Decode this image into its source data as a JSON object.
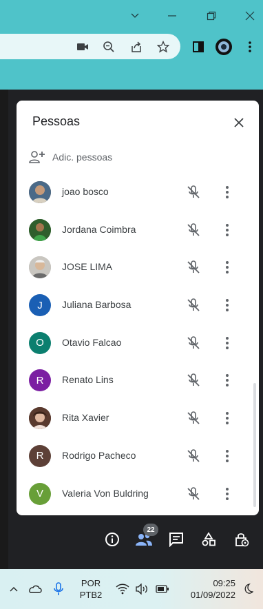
{
  "browser": {
    "window_controls": [
      "chevron-down-icon",
      "minimize-icon",
      "restore-icon",
      "close-icon"
    ],
    "toolbar_icons": [
      "camera-icon",
      "zoom-icon",
      "share-icon",
      "star-icon",
      "sidebar-icon",
      "profile-icon",
      "menu-icon"
    ],
    "accent": "#4fc3c9"
  },
  "panel": {
    "title": "Pessoas",
    "add_people_label": "Adic. pessoas",
    "participants": [
      {
        "name": "joao bosco",
        "initial": "",
        "color": "#7a5a44",
        "photo": true
      },
      {
        "name": "Jordana Coimbra",
        "initial": "",
        "color": "#3e7d3a",
        "photo": true
      },
      {
        "name": "JOSE LIMA",
        "initial": "",
        "color": "#9e9e9e",
        "photo": true
      },
      {
        "name": "Juliana Barbosa",
        "initial": "J",
        "color": "#1a5fb4",
        "photo": false
      },
      {
        "name": "Otavio Falcao",
        "initial": "O",
        "color": "#0b7f6f",
        "photo": false
      },
      {
        "name": "Renato Lins",
        "initial": "R",
        "color": "#7b1fa2",
        "photo": false
      },
      {
        "name": "Rita Xavier",
        "initial": "",
        "color": "#6d4c41",
        "photo": true
      },
      {
        "name": "Rodrigo Pacheco",
        "initial": "R",
        "color": "#5d4037",
        "photo": false
      },
      {
        "name": "Valeria Von Buldring",
        "initial": "V",
        "color": "#689f38",
        "photo": false
      }
    ]
  },
  "controls": {
    "people_count": "22",
    "icons": [
      "info-icon",
      "people-icon",
      "chat-icon",
      "activities-icon",
      "host-controls-icon"
    ]
  },
  "taskbar": {
    "lang_top": "POR",
    "lang_bottom": "PTB2",
    "time": "09:25",
    "date": "01/09/2022"
  }
}
